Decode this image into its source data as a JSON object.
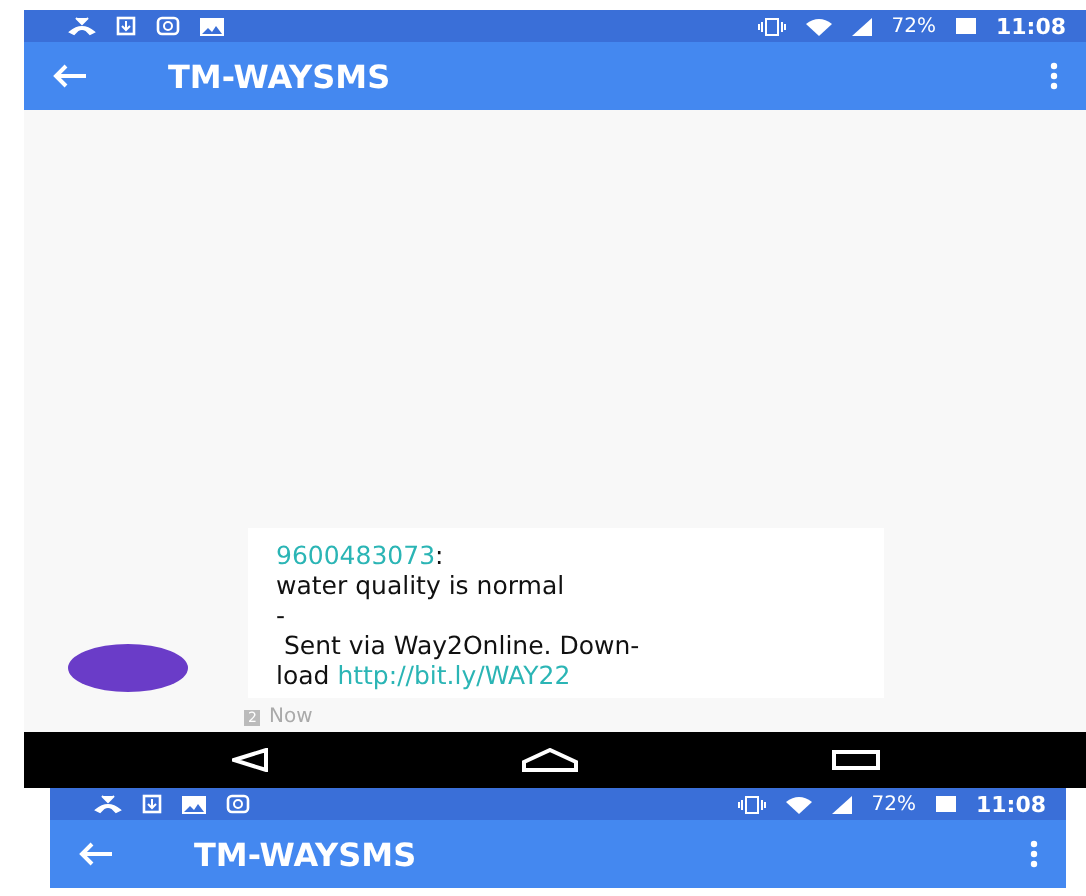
{
  "screens": [
    {
      "status_bar": {
        "notifications": [
          {
            "kind": "missed-call"
          },
          {
            "kind": "download"
          },
          {
            "kind": "camera"
          },
          {
            "kind": "image"
          }
        ],
        "battery": "72%",
        "time": "11:08"
      },
      "app_bar": {
        "title": "TM-WAYSMS"
      },
      "messages": [
        {
          "sender": "9600483073",
          "separator": ":",
          "body": "water quality is normal",
          "dash": "-",
          "footer": " Sent via Way2Online. Down-",
          "footer2": "load ",
          "link": "http://bit.ly/WAY22",
          "sim": "2",
          "time": "Now"
        }
      ]
    },
    {
      "status_bar": {
        "notifications": [
          {
            "kind": "missed-call"
          },
          {
            "kind": "download"
          },
          {
            "kind": "image"
          },
          {
            "kind": "camera"
          }
        ],
        "battery": "72%",
        "time": "11:08"
      },
      "app_bar": {
        "title": "TM-WAYSMS"
      }
    }
  ]
}
